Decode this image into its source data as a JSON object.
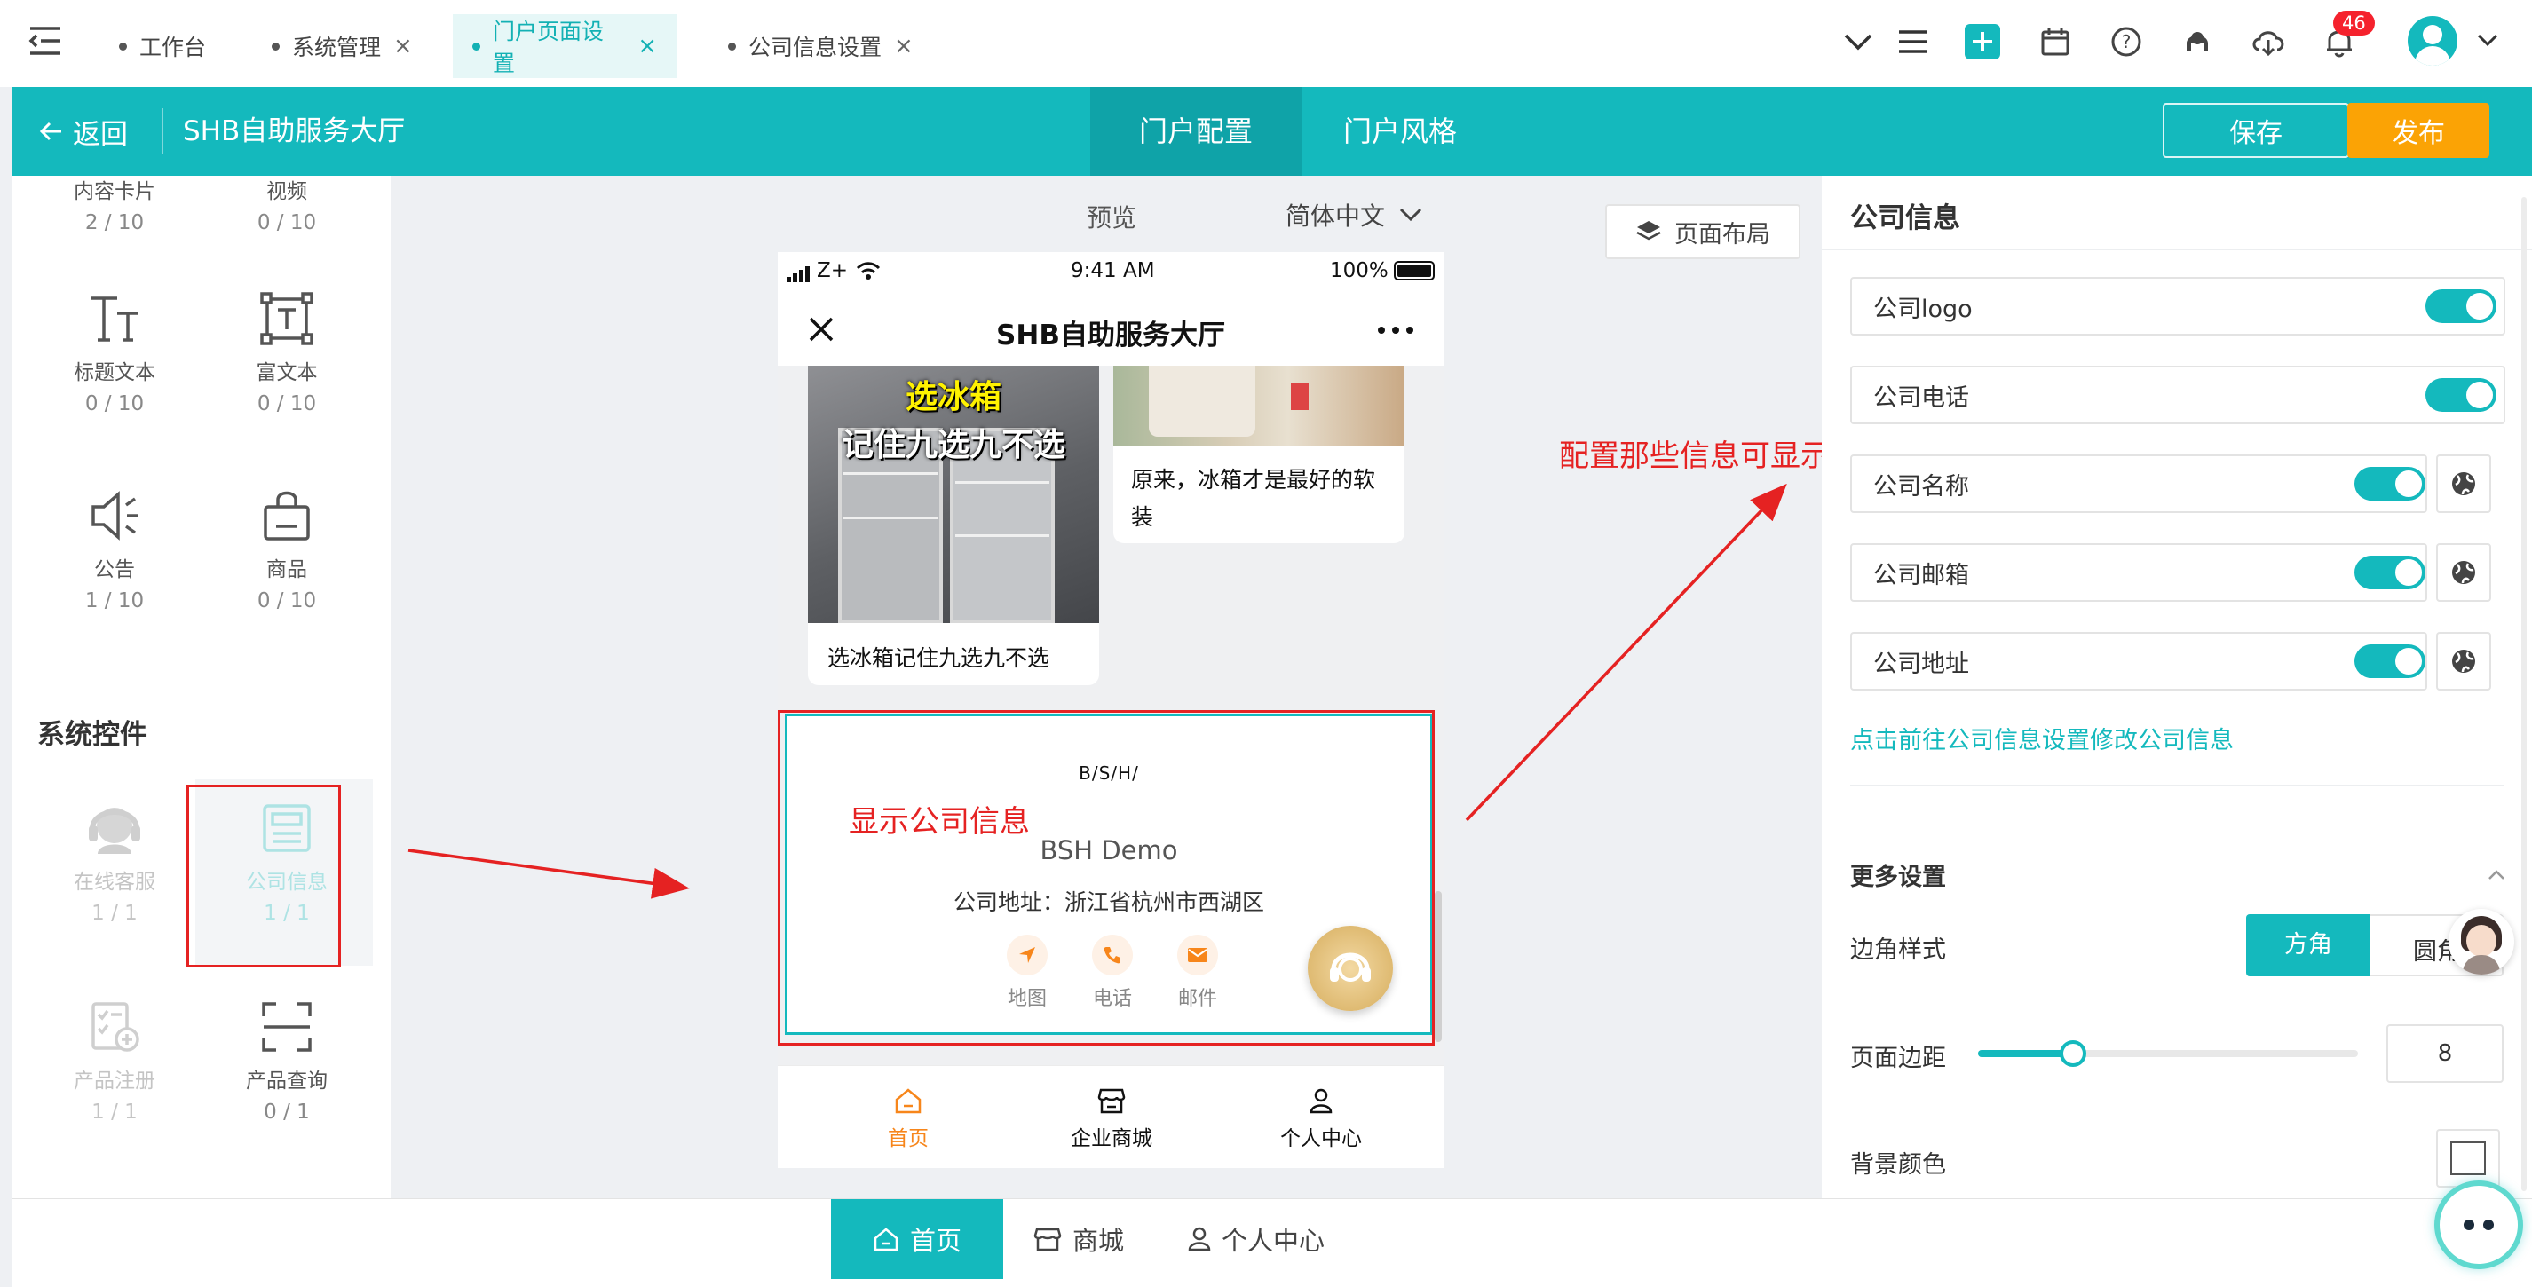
{
  "tabs": [
    {
      "label": "工作台",
      "closable": false
    },
    {
      "label": "系统管理",
      "closable": true
    },
    {
      "label": "门户页面设置",
      "closable": true,
      "active": true
    },
    {
      "label": "公司信息设置",
      "closable": true
    }
  ],
  "topbar": {
    "notification_count": "46"
  },
  "header": {
    "back_label": "返回",
    "title": "SHB自助服务大厅",
    "tab_config": "门户配置",
    "tab_style": "门户风格",
    "save_label": "保存",
    "publish_label": "发布"
  },
  "left_panel": {
    "top_items": [
      {
        "label": "内容卡片",
        "count": "2 / 10"
      },
      {
        "label": "视频",
        "count": "0 / 10"
      }
    ],
    "items": [
      {
        "label": "标题文本",
        "count": "0 / 10",
        "icon": "title-text-icon"
      },
      {
        "label": "富文本",
        "count": "0 / 10",
        "icon": "rich-text-icon"
      },
      {
        "label": "公告",
        "count": "1 / 10",
        "icon": "announcement-icon"
      },
      {
        "label": "商品",
        "count": "0 / 10",
        "icon": "product-icon"
      }
    ],
    "system_section_title": "系统控件",
    "system_items": [
      {
        "label": "在线客服",
        "count": "1 / 1",
        "icon": "customer-service-icon"
      },
      {
        "label": "公司信息",
        "count": "1 / 1",
        "icon": "company-info-icon"
      },
      {
        "label": "产品注册",
        "count": "1 / 1",
        "icon": "product-register-icon"
      },
      {
        "label": "产品查询",
        "count": "0 / 1",
        "icon": "product-query-icon"
      }
    ]
  },
  "canvas": {
    "preview_label": "预览",
    "language": "简体中文",
    "layout_button": "页面布局"
  },
  "phone": {
    "status_carrier": "Z+",
    "status_time": "9:41 AM",
    "status_battery": "100%",
    "title": "SHB自助服务大厅",
    "card1_overlay_title": "选冰箱",
    "card1_overlay_sub": "记住九选九不选",
    "card1_caption": "选冰箱记住九选九不选",
    "card2_caption": "原来，冰箱才是最好的软装",
    "company_logo_text": "B/S/H/",
    "company_name": "BSH Demo",
    "company_address": "公司地址：浙江省杭州市西湖区",
    "actions": [
      {
        "label": "地图",
        "icon": "map-icon"
      },
      {
        "label": "电话",
        "icon": "phone-icon"
      },
      {
        "label": "邮件",
        "icon": "mail-icon"
      }
    ],
    "nav": [
      {
        "label": "首页",
        "icon": "home-icon",
        "active": true
      },
      {
        "label": "企业商城",
        "icon": "shop-icon"
      },
      {
        "label": "个人中心",
        "icon": "user-icon"
      }
    ]
  },
  "annotations": {
    "show_company_info": "显示公司信息",
    "configure_info": "配置那些信息可显示"
  },
  "right_panel": {
    "title": "公司信息",
    "fields": [
      {
        "label": "公司logo",
        "enabled": true,
        "has_globe": false
      },
      {
        "label": "公司电话",
        "enabled": true,
        "has_globe": false
      },
      {
        "label": "公司名称",
        "enabled": true,
        "has_globe": true
      },
      {
        "label": "公司邮箱",
        "enabled": true,
        "has_globe": true
      },
      {
        "label": "公司地址",
        "enabled": true,
        "has_globe": true
      }
    ],
    "link_text": "点击前往公司信息设置修改公司信息",
    "more_settings": "更多设置",
    "corner_style_label": "边角样式",
    "corner_square": "方角",
    "corner_round": "圆角",
    "margin_label": "页面边距",
    "margin_value": "8",
    "margin_fraction": 0.25,
    "bg_color_label": "背景颜色"
  },
  "bottom_nav": [
    {
      "label": "首页",
      "icon": "home-icon",
      "active": true
    },
    {
      "label": "商城",
      "icon": "shop-icon"
    },
    {
      "label": "个人中心",
      "icon": "user-icon"
    }
  ],
  "colors": {
    "accent": "#14b9bd",
    "publish": "#fba305",
    "annotation": "#e52222",
    "badge": "#f5222d",
    "icon_orange": "#f7861b"
  }
}
